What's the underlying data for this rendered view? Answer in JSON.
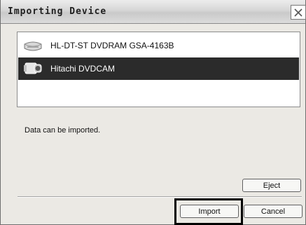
{
  "window": {
    "title": "Importing Device",
    "close_icon": "close-icon"
  },
  "devices": [
    {
      "label": "HL-DT-ST DVDRAM GSA-4163B",
      "icon": "disc-drive-icon",
      "selected": false
    },
    {
      "label": "Hitachi DVDCAM",
      "icon": "camcorder-icon",
      "selected": true
    }
  ],
  "message": "Data can be imported.",
  "buttons": {
    "eject": "Eject",
    "import": "Import",
    "cancel": "Cancel"
  },
  "colors": {
    "selection_bg": "#2b2b2b",
    "dialog_bg": "#ebe9e4",
    "highlight": "#000000"
  }
}
